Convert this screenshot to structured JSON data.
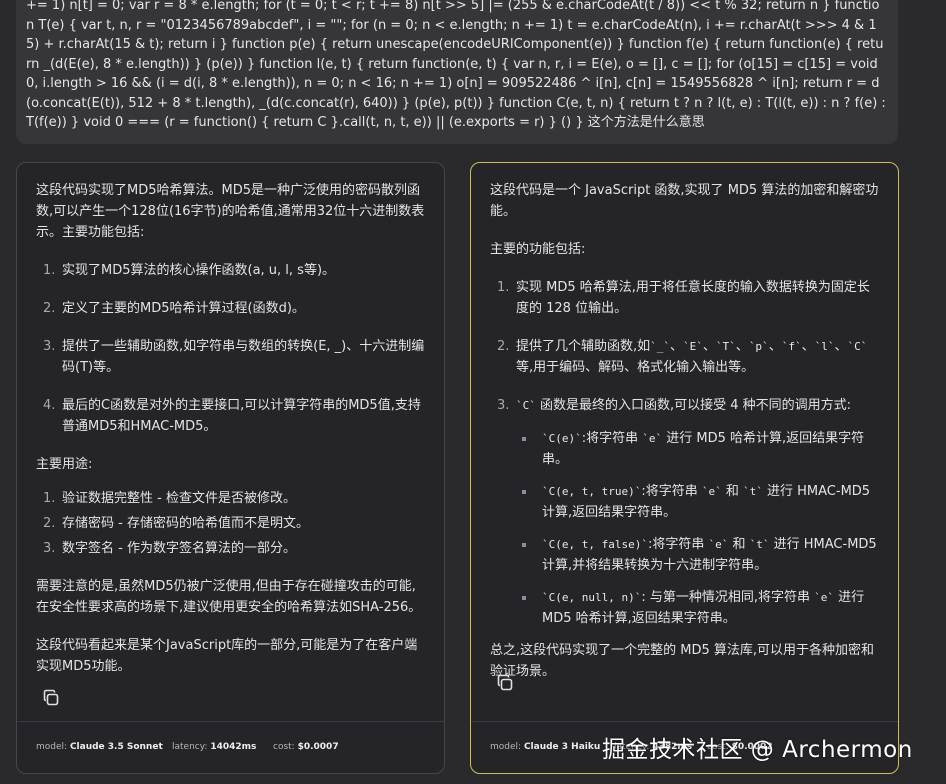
{
  "prompt": {
    "text": "+= 1) n[t] = 0; var r = 8 * e.length; for (t = 0; t < r; t += 8) n[t >> 5] |= (255 & e.charCodeAt(t / 8)) << t % 32; return n } function T(e) { var t, n, r = \"0123456789abcdef\", i = \"\"; for (n = 0; n < e.length; n += 1) t = e.charCodeAt(n), i += r.charAt(t >>> 4 & 15) + r.charAt(15 & t); return i } function p(e) { return unescape(encodeURIComponent(e)) } function f(e) { return function(e) { return _(d(E(e), 8 * e.length)) } (p(e)) } function l(e, t) { return function(e, t) { var n, r, i = E(e), o = [], c = []; for (o[15] = c[15] = void 0, i.length > 16 && (i = d(i, 8 * e.length)), n = 0; n < 16; n += 1) o[n] = 909522486 ^ i[n], c[n] = 1549556828 ^ i[n]; return r = d(o.concat(E(t)), 512 + 8 * t.length), _(d(c.concat(r), 640)) } (p(e), p(t)) } function C(e, t, n) { return t ? n ? l(t, e) : T(l(t, e)) : n ? f(e) : T(f(e)) } void 0 === (r = function() { return C }.call(t, n, t, e)) || (e.exports = r) } () } 这个方法是什么意思"
  },
  "left": {
    "intro": "这段代码实现了MD5哈希算法。MD5是一种广泛使用的密码散列函数,可以产生一个128位(16字节)的哈希值,通常用32位十六进制数表示。主要功能包括:",
    "features": [
      {
        "num": "1.",
        "text": "实现了MD5算法的核心操作函数(a, u, l, s等)。"
      },
      {
        "num": "2.",
        "text": "定义了主要的MD5哈希计算过程(函数d)。"
      },
      {
        "num": "3.",
        "text": "提供了一些辅助函数,如字符串与数组的转换(E, _)、十六进制编码(T)等。"
      },
      {
        "num": "4.",
        "text": "最后的C函数是对外的主要接口,可以计算字符串的MD5值,支持普通MD5和HMAC-MD5。"
      }
    ],
    "uses_heading": "主要用途:",
    "uses": [
      {
        "num": "1.",
        "text": "验证数据完整性 - 检查文件是否被修改。"
      },
      {
        "num": "2.",
        "text": "存储密码 - 存储密码的哈希值而不是明文。"
      },
      {
        "num": "3.",
        "text": "数字签名 - 作为数字签名算法的一部分。"
      }
    ],
    "note": "需要注意的是,虽然MD5仍被广泛使用,但由于存在碰撞攻击的可能,在安全性要求高的场景下,建议使用更安全的哈希算法如SHA-256。",
    "conclusion": "这段代码看起来是某个JavaScript库的一部分,可能是为了在客户端实现MD5功能。",
    "footer": {
      "model_label": "model:",
      "model": "Claude 3.5 Sonnet",
      "latency_label": "latency:",
      "latency": "14042ms",
      "cost_label": "cost:",
      "cost": "$0.0007"
    }
  },
  "right": {
    "intro": "这段代码是一个 JavaScript 函数,实现了 MD5 算法的加密和解密功能。",
    "features_heading": "主要的功能包括:",
    "f1": {
      "num": "1.",
      "text": "实现 MD5 哈希算法,用于将任意长度的输入数据转换为固定长度的 128 位输出。"
    },
    "f2": {
      "num": "2.",
      "pre": "提供了几个辅助函数,如",
      "codes": [
        "`_`",
        "`E`",
        "`T`",
        "`p`",
        "`f`",
        "`l`",
        "`C`"
      ],
      "post": "等,用于编码、解码、格式化输入输出等。"
    },
    "f3": {
      "num": "3.",
      "code": "`C`",
      "text": " 函数是最终的入口函数,可以接受 4 种不同的调用方式:"
    },
    "calls": [
      {
        "code": "`C(e)`",
        "pre": ":将字符串 ",
        "arg1": "`e`",
        "mid": "",
        "arg2": "",
        "post": " 进行 MD5 哈希计算,返回结果字符串。"
      },
      {
        "code": "`C(e, t, true)`",
        "pre": ":将字符串 ",
        "arg1": "`e`",
        "mid": " 和 ",
        "arg2": "`t`",
        "post": " 进行 HMAC-MD5 计算,返回结果字符串。"
      },
      {
        "code": "`C(e, t, false)`",
        "pre": ":将字符串 ",
        "arg1": "`e`",
        "mid": " 和 ",
        "arg2": "`t`",
        "post": " 进行 HMAC-MD5 计算,并将结果转换为十六进制字符串。"
      },
      {
        "code": "`C(e, null, n)`",
        "pre": ": 与第一种情况相同,将字符串 ",
        "arg1": "`e`",
        "mid": "",
        "arg2": "",
        "post": " 进行 MD5 哈希计算,返回结果字符串。"
      }
    ],
    "summary": "总之,这段代码实现了一个完整的 MD5 算法库,可以用于各种加密和验证场景。",
    "footer": {
      "model_label": "model:",
      "model": "Claude 3 Haiku",
      "latency_label": "latency:",
      "latency": "4382ms",
      "cost_label": "cost:",
      "cost": "$0.0002"
    }
  },
  "watermark": "掘金技术社区 @ Archermon",
  "colors": {
    "selected_border": "#c9c24e",
    "card_bg": "#252529",
    "prompt_bg": "#35353a"
  }
}
